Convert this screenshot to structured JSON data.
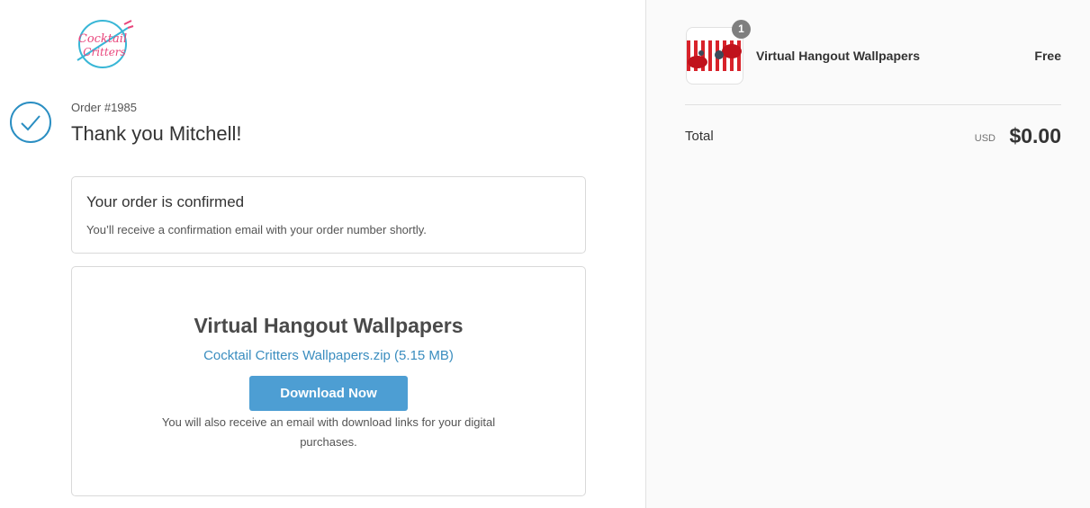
{
  "brand": {
    "logo_text_line1": "Cocktail",
    "logo_text_line2": "Critters"
  },
  "header": {
    "order_number": "Order #1985",
    "thank_you": "Thank you Mitchell!"
  },
  "confirmation": {
    "title": "Your order is confirmed",
    "message": "You’ll receive a confirmation email with your order number shortly."
  },
  "download": {
    "title": "Virtual Hangout Wallpapers",
    "file_link": "Cocktail Critters Wallpapers.zip (5.15 MB)",
    "button_label": "Download Now",
    "note": "You will also receive an email with download links for your digital purchases."
  },
  "summary": {
    "item": {
      "name": "Virtual Hangout Wallpapers",
      "price": "Free",
      "quantity": "1"
    },
    "total_label": "Total",
    "currency": "USD",
    "total_amount": "$0.00"
  },
  "colors": {
    "accent": "#4d9ed3",
    "link": "#3a8dbf",
    "check": "#2a8ec2",
    "logo_pink": "#e8457b",
    "logo_teal": "#38b6d6"
  },
  "icons": {
    "check": "check-circle-icon",
    "logo": "cocktail-critters-logo"
  }
}
